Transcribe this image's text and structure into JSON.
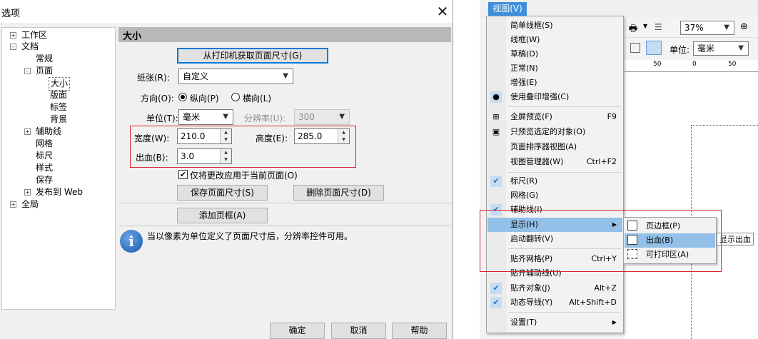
{
  "dialog": {
    "title": "选项",
    "close_glyph": "✕",
    "tree": [
      {
        "label": "工作区",
        "exp": "+"
      },
      {
        "label": "文档",
        "exp": "-"
      },
      {
        "label": "常规",
        "exp": ""
      },
      {
        "label": "页面",
        "exp": "-"
      },
      {
        "label": "大小",
        "exp": ""
      },
      {
        "label": "版面",
        "exp": ""
      },
      {
        "label": "标签",
        "exp": ""
      },
      {
        "label": "背景",
        "exp": ""
      },
      {
        "label": "辅助线",
        "exp": "+"
      },
      {
        "label": "网格",
        "exp": ""
      },
      {
        "label": "标尺",
        "exp": ""
      },
      {
        "label": "样式",
        "exp": ""
      },
      {
        "label": "保存",
        "exp": ""
      },
      {
        "label": "发布到 Web",
        "exp": "+"
      },
      {
        "label": "全局",
        "exp": "+"
      }
    ],
    "section_title": "大小",
    "get_printer_size_button": "从打印机获取页面尺寸(G)",
    "paper_label": "纸张(R):",
    "paper_value": "自定义",
    "orientation_label": "方向(O):",
    "portrait_label": "纵向(P)",
    "landscape_label": "横向(L)",
    "orientation_selected": "portrait",
    "unit_label": "单位(T):",
    "unit_value": "毫米",
    "resolution_label": "分辨率(U):",
    "resolution_value": "300",
    "width_label": "宽度(W):",
    "width_value": "210.0",
    "height_label": "高度(E):",
    "height_value": "285.0",
    "bleed_label": "出血(B):",
    "bleed_value": "3.0",
    "apply_current_only_label": "仅将更改应用于当前页面(O)",
    "apply_current_only_checked": true,
    "check_glyph": "✔",
    "save_size_button": "保存页面尺寸(S)",
    "delete_size_button": "删除页面尺寸(D)",
    "add_frame_button": "添加页框(A)",
    "info_glyph": "i",
    "info_text": "当以像素为单位定义了页面尺寸后，分辨率控件可用。",
    "ok_button": "确定",
    "cancel_button": "取消",
    "help_button": "帮助",
    "highlight_color": "#d4252d"
  },
  "app": {
    "menu_view_label": "视图(V)",
    "zoom_value": "37%",
    "unit_label": "单位:",
    "unit_value": "毫米",
    "ruler_labels": [
      "50",
      "0",
      "50"
    ],
    "view_menu": [
      {
        "label": "简单线框(S)",
        "shortcut": "",
        "icon": ""
      },
      {
        "label": "线框(W)",
        "shortcut": "",
        "icon": ""
      },
      {
        "label": "草稿(D)",
        "shortcut": "",
        "icon": ""
      },
      {
        "label": "正常(N)",
        "shortcut": "",
        "icon": ""
      },
      {
        "label": "增强(E)",
        "shortcut": "",
        "icon": ""
      },
      {
        "label": "使用叠印增强(C)",
        "shortcut": "",
        "icon": "●"
      },
      {
        "label": "全屏预览(F)",
        "shortcut": "F9",
        "icon": "⊞"
      },
      {
        "label": "只预览选定的对象(O)",
        "shortcut": "",
        "icon": "▣"
      },
      {
        "label": "页面排序器视图(A)",
        "shortcut": "",
        "icon": ""
      },
      {
        "label": "视图管理器(W)",
        "shortcut": "Ctrl+F2",
        "icon": ""
      },
      {
        "label": "标尺(R)",
        "shortcut": "",
        "icon": "✔"
      },
      {
        "label": "网格(G)",
        "shortcut": "",
        "icon": ""
      },
      {
        "label": "辅助线(I)",
        "shortcut": "",
        "icon": "✔"
      },
      {
        "label": "显示(H)",
        "shortcut": "▶",
        "icon": ""
      },
      {
        "label": "启动翻转(V)",
        "shortcut": "",
        "icon": ""
      },
      {
        "label": "贴齐网格(P)",
        "shortcut": "Ctrl+Y",
        "icon": ""
      },
      {
        "label": "贴齐辅助线(U)",
        "shortcut": "",
        "icon": ""
      },
      {
        "label": "贴齐对象(J)",
        "shortcut": "Alt+Z",
        "icon": "✔"
      },
      {
        "label": "动态导线(Y)",
        "shortcut": "Alt+Shift+D",
        "icon": "✔"
      },
      {
        "label": "设置(T)",
        "shortcut": "▶",
        "icon": ""
      }
    ],
    "show_submenu": [
      {
        "label": "页边框(P)"
      },
      {
        "label": "出血(B)"
      },
      {
        "label": "可打印区(A)"
      }
    ],
    "tooltip": "显示出血"
  }
}
